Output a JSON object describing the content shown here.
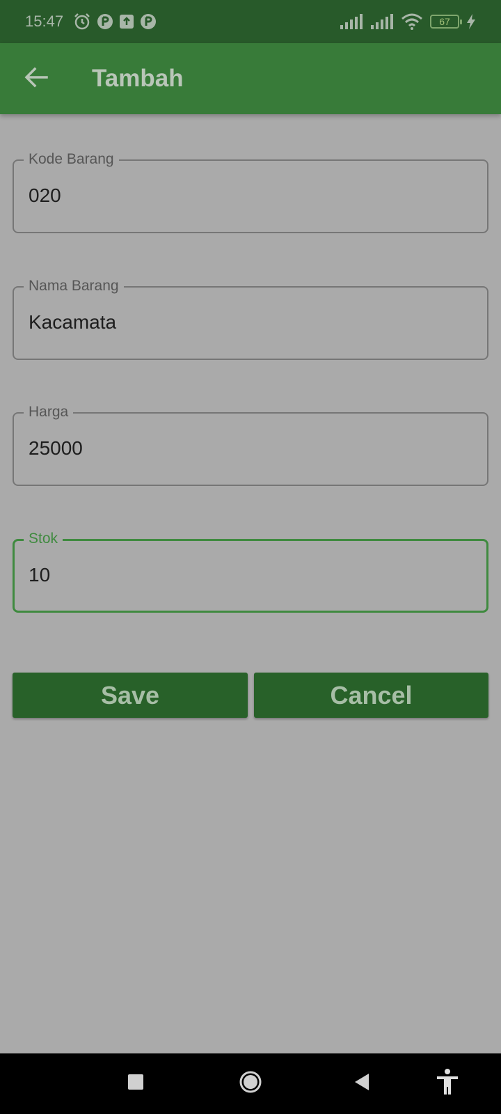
{
  "status_bar": {
    "time": "15:47",
    "battery_level": "67",
    "icons": [
      "alarm-icon",
      "app-notification-icon",
      "upload-icon",
      "app-notification-icon",
      "signal-icon",
      "signal-icon",
      "wifi-icon",
      "battery-icon",
      "charging-icon"
    ]
  },
  "app_bar": {
    "title": "Tambah",
    "back_icon": "arrow-left-icon",
    "color": "#387b39"
  },
  "form": {
    "fields": [
      {
        "label": "Kode Barang",
        "value": "020",
        "focused": false
      },
      {
        "label": "Nama Barang",
        "value": "Kacamata",
        "focused": false
      },
      {
        "label": "Harga",
        "value": "25000",
        "focused": false
      },
      {
        "label": "Stok",
        "value": "10",
        "focused": true
      }
    ],
    "focus_color": "#3f8a3f"
  },
  "buttons": {
    "save_label": "Save",
    "cancel_label": "Cancel",
    "color": "#286129"
  },
  "nav_bar": {
    "items": [
      "recents-square-icon",
      "home-circle-icon",
      "back-triangle-icon",
      "accessibility-icon"
    ]
  }
}
